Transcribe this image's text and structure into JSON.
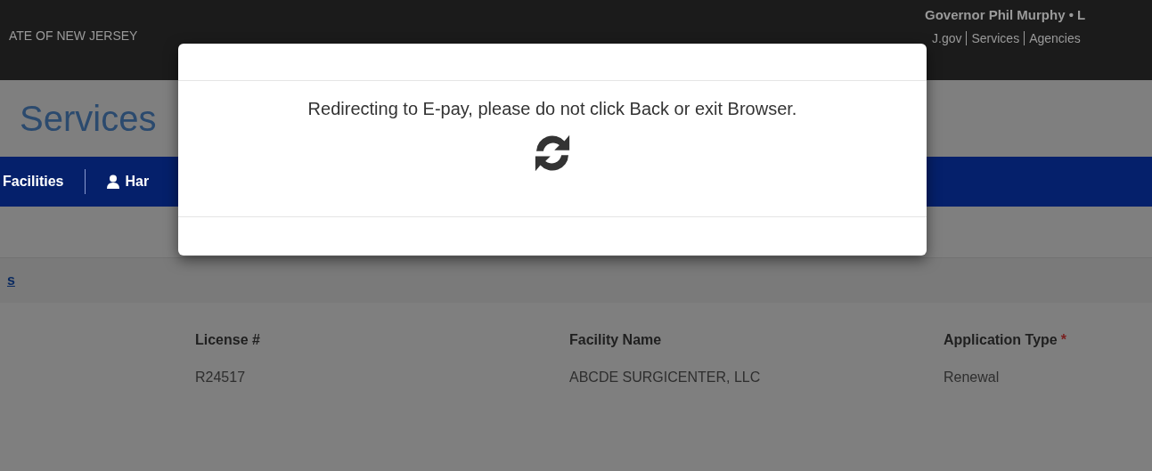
{
  "top_bar": {
    "state_name": "ATE OF NEW JERSEY",
    "governor": "Governor Phil Murphy • L",
    "links": [
      "J.gov",
      "Services",
      "Agencies"
    ]
  },
  "site_title": "Services",
  "nav": [
    {
      "label": "Facilities",
      "kind": "text"
    },
    {
      "label": "Har",
      "kind": "user"
    }
  ],
  "breadcrumb_link": "s",
  "table": {
    "columns": [
      {
        "label": "License #"
      },
      {
        "label": "Facility Name"
      },
      {
        "label": "Application Type",
        "required_mark": "*"
      }
    ],
    "rows": [
      [
        "R24517",
        "ABCDE SURGICENTER, LLC",
        "Renewal"
      ]
    ]
  },
  "modal": {
    "message": "Redirecting to E-pay, please do not click Back or exit Browser."
  }
}
